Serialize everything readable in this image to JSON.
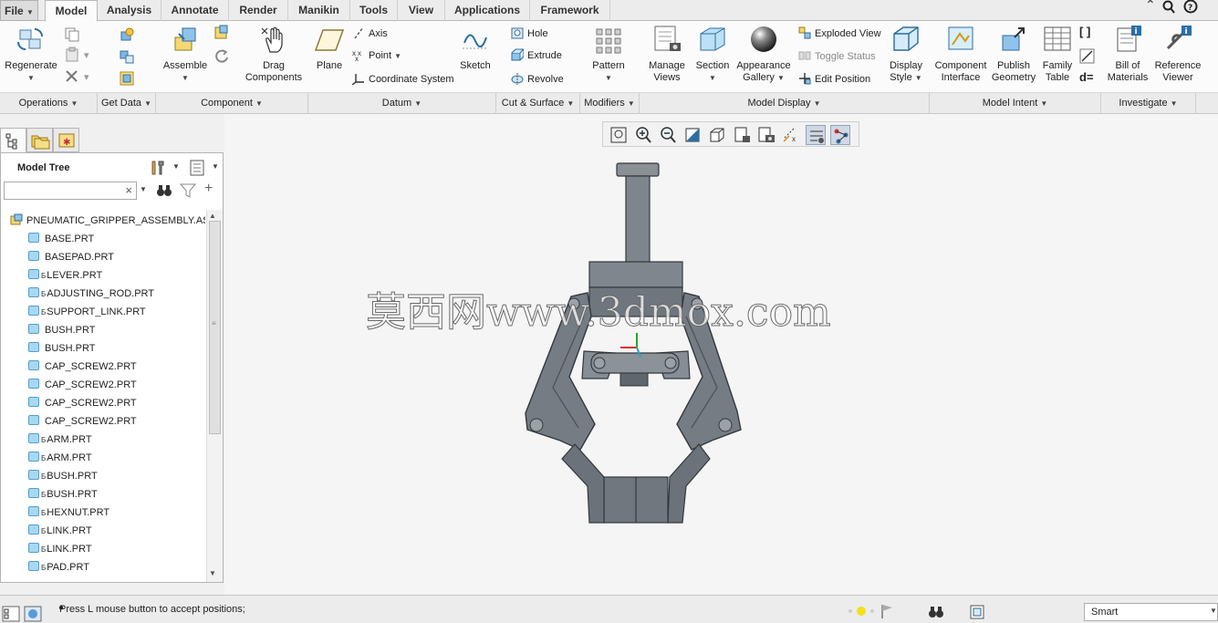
{
  "menu": {
    "file": "File",
    "tabs": [
      "Model",
      "Analysis",
      "Annotate",
      "Render",
      "Manikin",
      "Tools",
      "View",
      "Applications",
      "Framework"
    ],
    "active": "Model"
  },
  "ribbon": {
    "regenerate": "Regenerate",
    "assemble": "Assemble",
    "drag": [
      "Drag",
      "Components"
    ],
    "plane": "Plane",
    "axis": "Axis",
    "point": "Point",
    "coordsys": "Coordinate System",
    "sketch": "Sketch",
    "hole": "Hole",
    "extrude": "Extrude",
    "revolve": "Revolve",
    "pattern": "Pattern",
    "manage_views": [
      "Manage",
      "Views"
    ],
    "section": "Section",
    "appearance": [
      "Appearance",
      "Gallery"
    ],
    "exploded": "Exploded View",
    "toggle": "Toggle Status",
    "edit_position": "Edit Position",
    "display_style": [
      "Display",
      "Style"
    ],
    "component_interface": [
      "Component",
      "Interface"
    ],
    "publish_geometry": [
      "Publish",
      "Geometry"
    ],
    "family_table": [
      "Family",
      "Table"
    ],
    "bill_of_materials": [
      "Bill of",
      "Materials"
    ],
    "reference_viewer": [
      "Reference",
      "Viewer"
    ]
  },
  "groups": [
    "Operations",
    "Get Data",
    "Component",
    "Datum",
    "Cut & Surface",
    "Modifiers",
    "Model Display",
    "Model Intent",
    "Investigate"
  ],
  "tree": {
    "title": "Model Tree",
    "root": "PNEUMATIC_GRIPPER_ASSEMBLY.ASM",
    "items": [
      {
        "name": "BASE.PRT",
        "ref": ""
      },
      {
        "name": "BASEPAD.PRT",
        "ref": ""
      },
      {
        "name": "LEVER.PRT",
        "ref": "Б"
      },
      {
        "name": "ADJUSTING_ROD.PRT",
        "ref": "Б"
      },
      {
        "name": "SUPPORT_LINK.PRT",
        "ref": "Б"
      },
      {
        "name": "BUSH.PRT",
        "ref": ""
      },
      {
        "name": "BUSH.PRT",
        "ref": ""
      },
      {
        "name": "CAP_SCREW2.PRT",
        "ref": ""
      },
      {
        "name": "CAP_SCREW2.PRT",
        "ref": ""
      },
      {
        "name": "CAP_SCREW2.PRT",
        "ref": ""
      },
      {
        "name": "CAP_SCREW2.PRT",
        "ref": ""
      },
      {
        "name": "ARM.PRT",
        "ref": "Б"
      },
      {
        "name": "ARM.PRT",
        "ref": "Б"
      },
      {
        "name": "BUSH.PRT",
        "ref": "Б"
      },
      {
        "name": "BUSH.PRT",
        "ref": "Б"
      },
      {
        "name": "HEXNUT.PRT",
        "ref": "Б"
      },
      {
        "name": "LINK.PRT",
        "ref": "Б"
      },
      {
        "name": "LINK.PRT",
        "ref": "Б"
      },
      {
        "name": "PAD.PRT",
        "ref": "Б"
      }
    ]
  },
  "watermark": "莫西网www.3dmox.com",
  "status": {
    "message": "Press L mouse button to accept positions;",
    "filter": "Smart"
  }
}
